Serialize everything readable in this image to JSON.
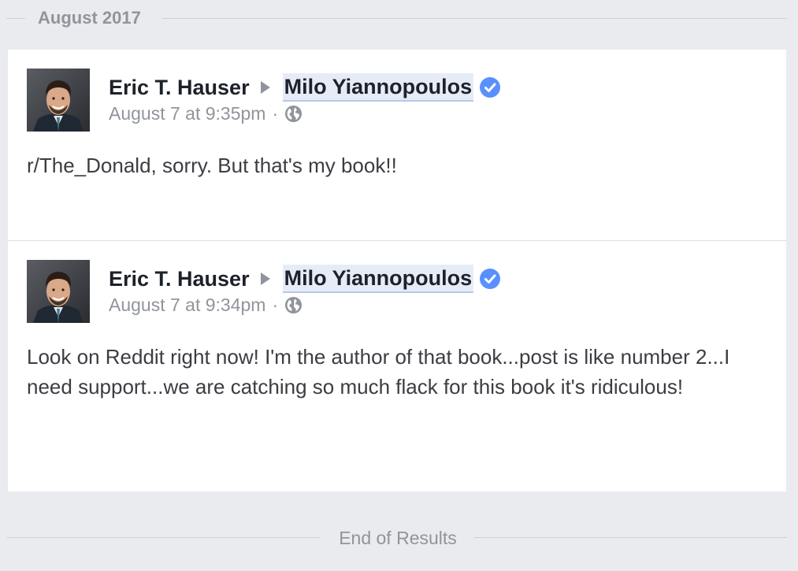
{
  "section": {
    "title": "August 2017"
  },
  "posts": [
    {
      "author": "Eric T. Hauser",
      "target": "Milo Yiannopoulos",
      "verified_icon": "verified-badge-icon",
      "timestamp": "August 7 at 9:35pm",
      "separator": "·",
      "privacy_icon": "globe-icon",
      "text": "r/The_Donald, sorry. But that's my book!!"
    },
    {
      "author": "Eric T. Hauser",
      "target": "Milo Yiannopoulos",
      "verified_icon": "verified-badge-icon",
      "timestamp": "August 7 at 9:34pm",
      "separator": "·",
      "privacy_icon": "globe-icon",
      "text": "Look on Reddit right now! I'm the author of that book...post is like number 2...I need support...we are catching so much flack for this book it's ridiculous!"
    }
  ],
  "footer": {
    "text": "End of Results"
  },
  "colors": {
    "page_background": "#e9ebee",
    "card_background": "#ffffff",
    "verified_blue": "#5890ff",
    "muted_text": "#90949c",
    "name_text": "#1d2129",
    "highlight": "#e6ecf7"
  }
}
